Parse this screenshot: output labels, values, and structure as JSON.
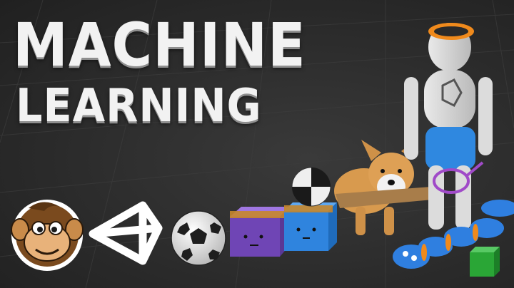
{
  "thumbnail": {
    "title_line1": "MACHINE",
    "title_line2": "LEARNING"
  },
  "colors": {
    "background": "#2e2e2e",
    "title_text": "#f2f2f2",
    "robot_accent": "#f08a1c",
    "robot_pants": "#2f88e0",
    "corgi": "#e0a050",
    "purple_cube": "#8a5bd0",
    "blue_cube": "#3a8ee6",
    "worm": "#2f7fe0",
    "green_cube": "#2fae3a"
  },
  "icons": [
    "code-monkey-logo",
    "unity-logo",
    "soccer-ball",
    "robot-agent",
    "corgi-agent",
    "worm-agent"
  ]
}
